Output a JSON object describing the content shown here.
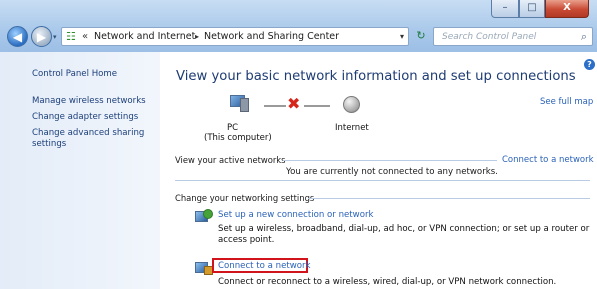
{
  "window": {
    "caption_buttons": {
      "minimize": "–",
      "maximize": "□",
      "close": "X"
    }
  },
  "nav": {
    "back_icon": "back-arrow",
    "forward_icon": "forward-arrow",
    "back_glyph": "◀",
    "forward_glyph": "▶",
    "dropdown_glyph": "▾"
  },
  "address": {
    "overflow": "«",
    "crumbs": [
      "Network and Internet",
      "Network and Sharing Center"
    ],
    "separator": "▸",
    "dropdown_glyph": "▾",
    "refresh_glyph": "↻"
  },
  "search": {
    "placeholder": "Search Control Panel",
    "icon_glyph": "⌕"
  },
  "sidebar": {
    "items": [
      {
        "label": "Control Panel Home"
      },
      {
        "label": "Manage wireless networks"
      },
      {
        "label": "Change adapter settings"
      },
      {
        "label": "Change advanced sharing settings"
      }
    ]
  },
  "main": {
    "help_glyph": "?",
    "title": "View your basic network information and set up connections",
    "see_full_map": "See full map",
    "map": {
      "pc_label": "PC",
      "this_computer": "(This computer)",
      "internet_label": "Internet",
      "broken_glyph": "✖"
    },
    "active_networks": {
      "heading": "View your active networks",
      "connect_link": "Connect to a network",
      "status": "You are currently not connected to any networks."
    },
    "settings": {
      "heading": "Change your networking settings",
      "tasks": [
        {
          "link": "Set up a new connection or network",
          "desc": "Set up a wireless, broadband, dial-up, ad hoc, or VPN connection; or set up a router or access point."
        },
        {
          "link": "Connect to a network",
          "desc": "Connect or reconnect to a wireless, wired, dial-up, or VPN network connection.",
          "highlighted": true
        }
      ]
    }
  },
  "colors": {
    "link": "#2a62b8",
    "title": "#1e3c74",
    "highlight_box": "#d1131c",
    "broken_x": "#d6261b"
  }
}
